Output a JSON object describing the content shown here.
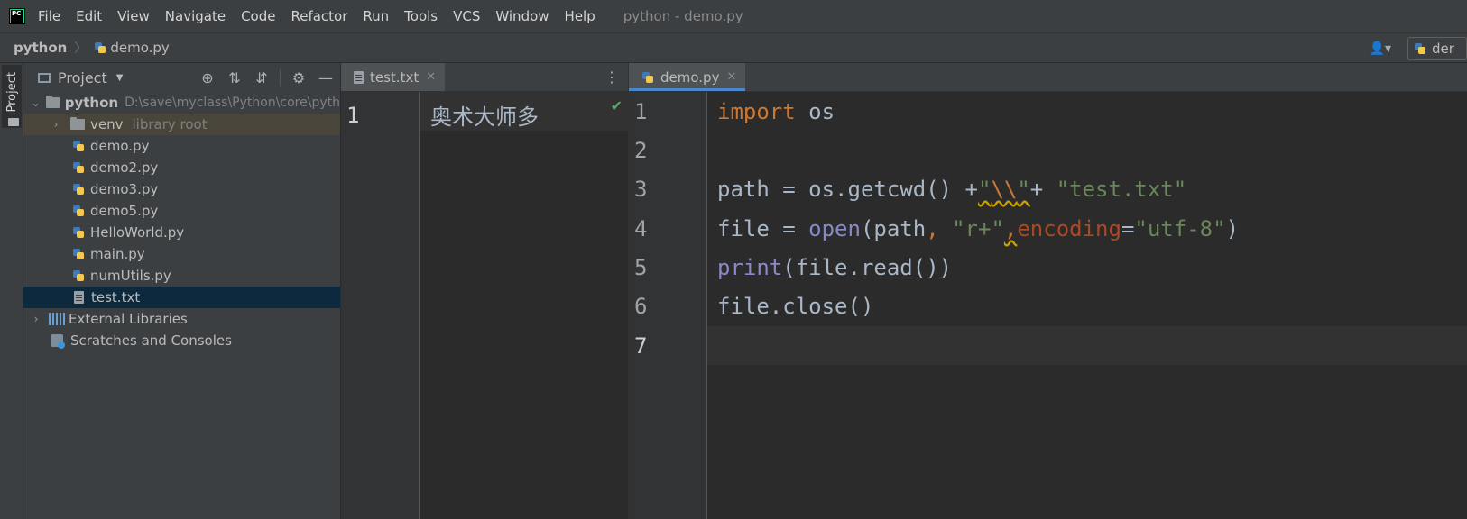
{
  "app": {
    "menu": [
      "File",
      "Edit",
      "View",
      "Navigate",
      "Code",
      "Refactor",
      "Run",
      "Tools",
      "VCS",
      "Window",
      "Help"
    ],
    "window_title": "python - demo.py"
  },
  "breadcrumb": {
    "root": "python",
    "file": "demo.py"
  },
  "run_config": {
    "label": "der"
  },
  "side_strip": {
    "project_label": "Project"
  },
  "project": {
    "title": "Project",
    "root": {
      "name": "python",
      "path": "D:\\save\\myclass\\Python\\core\\pyth"
    },
    "venv": {
      "name": "venv",
      "note": "library root"
    },
    "files": [
      "demo.py",
      "demo2.py",
      "demo3.py",
      "demo5.py",
      "HelloWorld.py",
      "main.py",
      "numUtils.py",
      "test.txt"
    ],
    "external": "External Libraries",
    "scratches": "Scratches and Consoles"
  },
  "editor_left": {
    "tab": "test.txt",
    "line_number": "1",
    "content": "奥术大师多"
  },
  "editor_right": {
    "tab": "demo.py",
    "line_numbers": [
      "1",
      "2",
      "3",
      "4",
      "5",
      "6",
      "7"
    ],
    "code": {
      "l1_kw": "import",
      "l1_rest": " os",
      "l3_a": "path = os.getcwd() +",
      "l3_q1": "\"",
      "l3_esc": "\\\\",
      "l3_q2": "\"",
      "l3_plus": "+ ",
      "l3_str": "\"test.txt\"",
      "l4_a": "file = ",
      "l4_open": "open",
      "l4_b": "(path",
      "l4_c1": ", ",
      "l4_s1": "\"r+\"",
      "l4_c2": ",",
      "l4_param": "encoding",
      "l4_eq": "=",
      "l4_s2": "\"utf-8\"",
      "l4_end": ")",
      "l5_fn": "print",
      "l5_rest": "(file.read())",
      "l6": "file.close()"
    }
  }
}
